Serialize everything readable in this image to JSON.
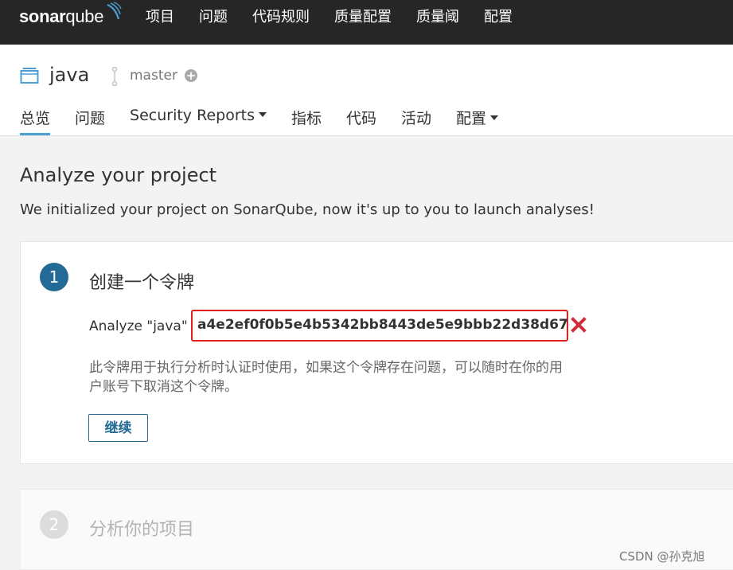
{
  "app": {
    "logo_main": "sonar",
    "logo_q": "qube"
  },
  "top_nav": [
    "项目",
    "问题",
    "代码规则",
    "质量配置",
    "质量阈",
    "配置"
  ],
  "project": {
    "name": "java",
    "branch": "master",
    "branch_add_icon": "plus-circle-icon"
  },
  "tabs": [
    {
      "label": "总览",
      "active": true,
      "dropdown": false
    },
    {
      "label": "问题",
      "active": false,
      "dropdown": false
    },
    {
      "label": "Security Reports",
      "active": false,
      "dropdown": true
    },
    {
      "label": "指标",
      "active": false,
      "dropdown": false
    },
    {
      "label": "代码",
      "active": false,
      "dropdown": false
    },
    {
      "label": "活动",
      "active": false,
      "dropdown": false
    },
    {
      "label": "配置",
      "active": false,
      "dropdown": true
    }
  ],
  "main": {
    "title": "Analyze your project",
    "subtitle": "We initialized your project on SonarQube, now it's up to you to launch analyses!"
  },
  "step1": {
    "number": "1",
    "title": "创建一个令牌",
    "analyze_label": "Analyze \"java\"",
    "token": "a4e2ef0f0b5e4b5342bb8443de5e9bbb22d38d67",
    "note": "此令牌用于执行分析时认证时使用，如果这个令牌存在问题，可以随时在你的用户账号下取消这个令牌。",
    "continue_label": "继续"
  },
  "step2": {
    "number": "2",
    "title": "分析你的项目"
  },
  "watermark": "CSDN @孙克旭",
  "colors": {
    "topbar": "#262626",
    "accent": "#236a97",
    "active_tab": "#4b9fd5",
    "highlight": "#e02020",
    "delete": "#d02f3a"
  }
}
